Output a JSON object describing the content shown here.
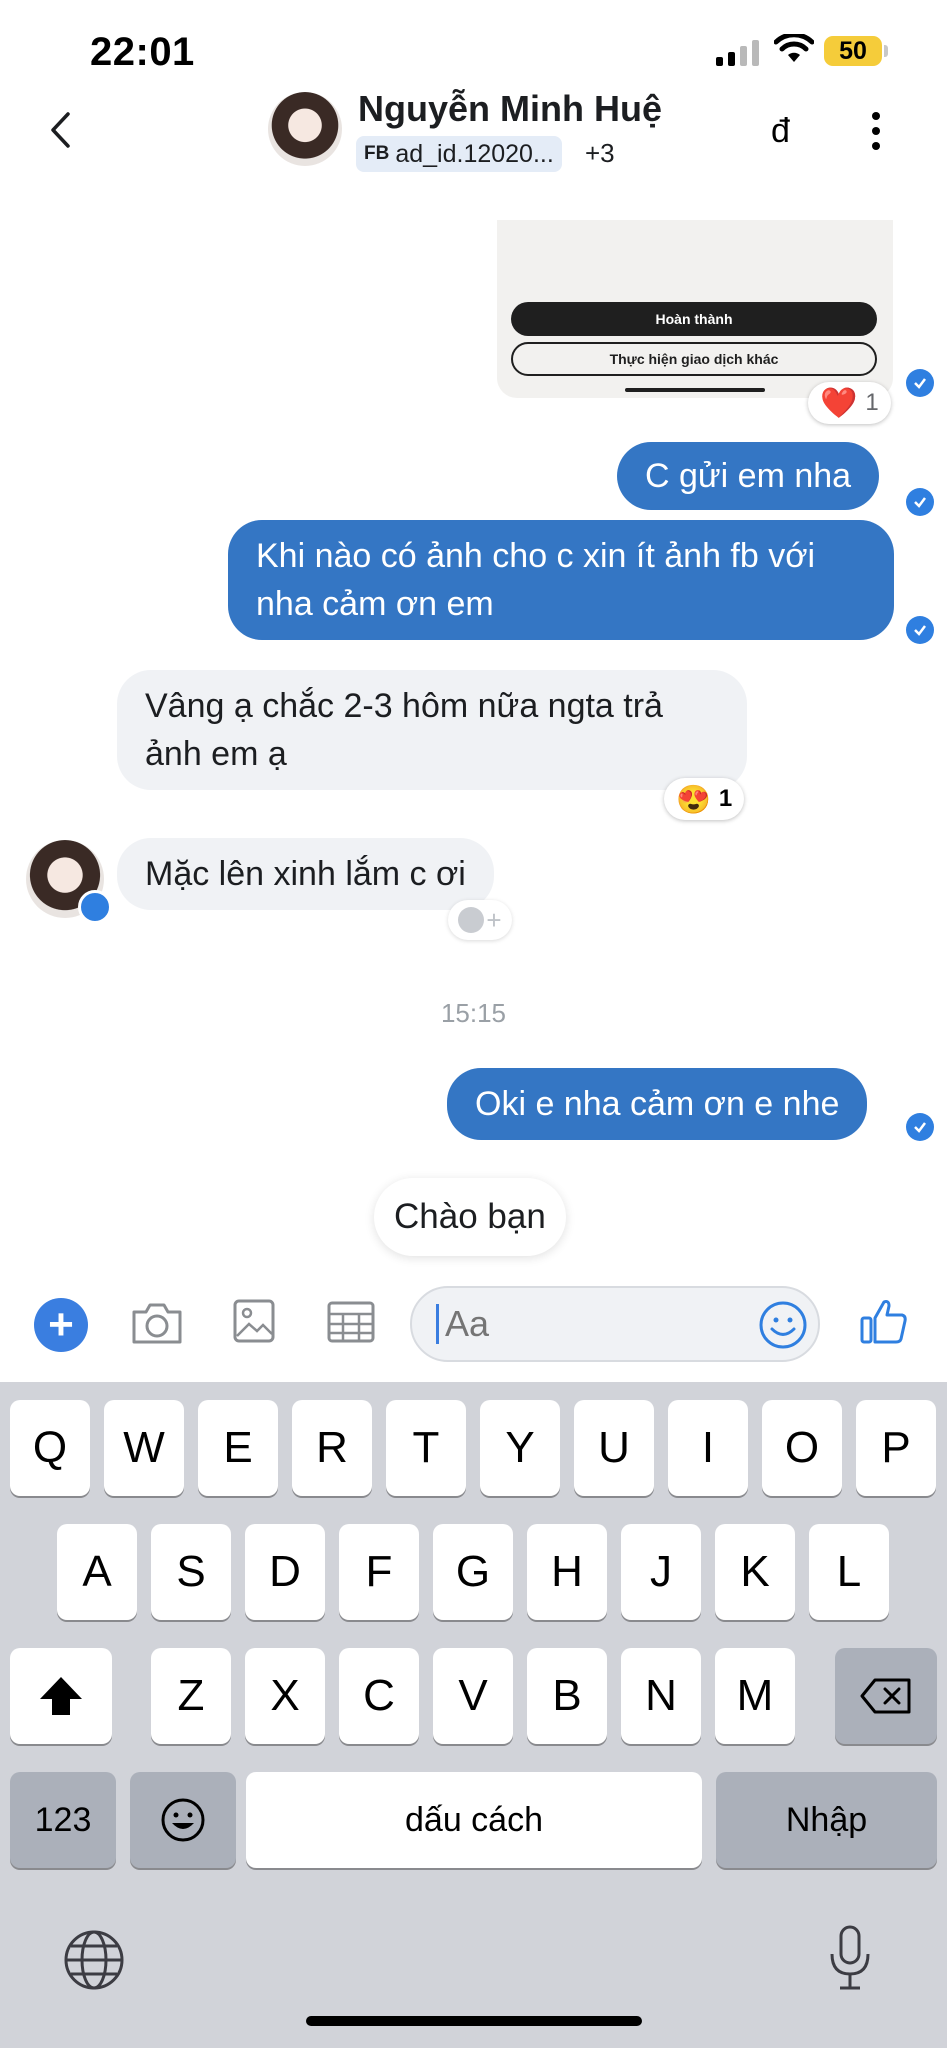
{
  "status_bar": {
    "time": "22:01",
    "battery": "50"
  },
  "header": {
    "name": "Nguyễn Minh Huệ",
    "tag_prefix": "FB",
    "tag": "ad_id.12020...",
    "extra_tags": "+3",
    "currency_symbol": "đ"
  },
  "image_message": {
    "primary_button": "Hoàn thành",
    "secondary_button": "Thực hiện giao dịch khác",
    "reaction_emoji": "❤️",
    "reaction_count": "1"
  },
  "messages": [
    {
      "side": "out",
      "text": "C gửi em nha"
    },
    {
      "side": "out",
      "text": "Khi nào có ảnh cho c xin ít ảnh fb với nha cảm ơn em"
    },
    {
      "side": "in",
      "text": "Vâng ạ chắc 2-3 hôm nữa ngta trả ảnh em ạ",
      "reaction_emoji": "😍",
      "reaction_count": "1"
    },
    {
      "side": "in",
      "text": "Mặc lên xinh lắm c ơi"
    },
    {
      "side": "out",
      "text": "Oki e nha cảm ơn e nhe"
    }
  ],
  "time_separator": "15:15",
  "quick_reply": "Chào bạn",
  "composer": {
    "placeholder": "Aa"
  },
  "keyboard": {
    "row1": [
      "Q",
      "W",
      "E",
      "R",
      "T",
      "Y",
      "U",
      "I",
      "O",
      "P"
    ],
    "row2": [
      "A",
      "S",
      "D",
      "F",
      "G",
      "H",
      "J",
      "K",
      "L"
    ],
    "row3": [
      "Z",
      "X",
      "C",
      "V",
      "B",
      "N",
      "M"
    ],
    "numbers_key": "123",
    "space_key": "dấu cách",
    "return_key": "Nhập"
  }
}
